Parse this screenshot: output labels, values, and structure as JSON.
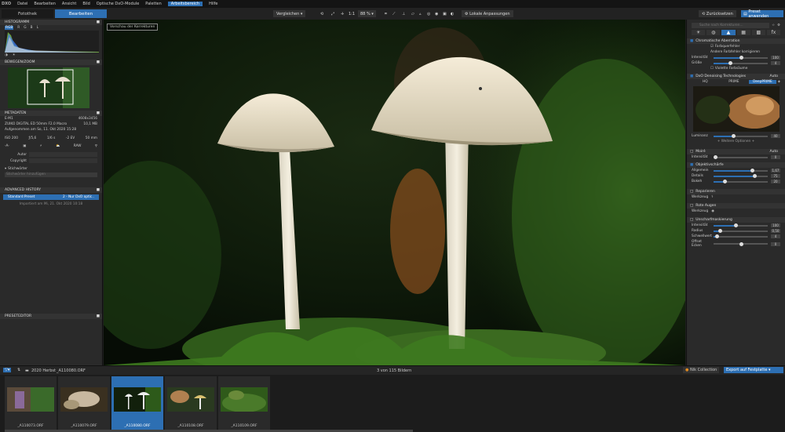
{
  "app": {
    "logo": "DXO"
  },
  "menu": [
    "Datei",
    "Bearbeiten",
    "Ansicht",
    "Bild",
    "Optische DxO-Module",
    "Paletten",
    "Arbeitsbereich",
    "Hilfe"
  ],
  "tabs": {
    "fototek": "Fotothek",
    "bearbeiten": "Bearbeiten"
  },
  "toolbar": {
    "compare": "Vergleichen",
    "zoom_fit": "1:1",
    "zoom": "88 %",
    "local": "Lokale Anpassungen",
    "reset": "Zurücksetzen",
    "preset": "Preset anwenden"
  },
  "left": {
    "histogram": "HISTOGRAMM",
    "hist_channels": [
      "RGB",
      "R",
      "G",
      "B",
      "L"
    ],
    "navigator": "BEWEGEN/ZOOM",
    "metadata": "METADATEN",
    "camera": "E-M1",
    "dims": "4608x3456",
    "lens": "ZUIKO DIGITAL ED 50mm F2.0 Macro",
    "size": "10,1 MB",
    "taken": "Aufgenommen am So, 11. Okt 2020 15:28",
    "exif": [
      "ISO 200",
      "ƒ/5,6",
      "1/6 s",
      "-2 EV",
      "50 mm"
    ],
    "author_label": "Autor",
    "copyright_label": "Copyright",
    "keywords": "Stichwörter",
    "keywords_ph": "Stichwörter hinzufügen",
    "history": "ADVANCED HISTORY",
    "hist_item1": "Standard Preset",
    "hist_item1b": "2 - Nur DxO optic..",
    "hist_note": "Importiert am Mi, 21. Okt 2020 10:18",
    "preset_editor": "PRESETEDITOR"
  },
  "viewer": {
    "label": "Vorschau der Korrekturen"
  },
  "right": {
    "search_ph": "Suche nach Korrekturen...",
    "ca": "Chromatische Aberration",
    "ca_opt1": "Farbquerfehler",
    "ca_opt2": "Andere Farbfehler korrigieren",
    "ca_int": "Intensität",
    "ca_int_v": "100",
    "ca_size": "Größe",
    "ca_size_v": "4",
    "ca_opt3": "Violette Farbsäume",
    "denoise": "DxO Denoising Technologies",
    "denoise_auto": "Auto",
    "dn_modes": [
      "HQ",
      "PRIME",
      "DeepPRIME"
    ],
    "luminance": "Luminanz",
    "lum_v": "40",
    "more": "+ Weitere Optionen +",
    "moire": "Moiré",
    "moire_auto": "Auto",
    "moire_int": "Intensität",
    "moire_v": "0",
    "sharp": "Objektivschärfe",
    "sharp_rows": [
      {
        "label": "Allgemein",
        "v": "1,67"
      },
      {
        "label": "Details",
        "v": "75"
      },
      {
        "label": "Bokeh",
        "v": "20"
      }
    ],
    "repair": "Reparieren",
    "tool": "Werkzeug",
    "redeye": "Rote Augen",
    "tool2": "Werkzeug",
    "usm": "Unscharfmaskierung",
    "usm_rows": [
      {
        "label": "Intensität",
        "v": "100"
      },
      {
        "label": "Radius",
        "v": "0,50"
      },
      {
        "label": "Schwellwert",
        "v": "4"
      },
      {
        "label": "Offset Ecken",
        "v": "0"
      }
    ]
  },
  "filmbar": {
    "folder": "2020 Herbst",
    "file": "_A110080.ORF",
    "count": "3 von 115 Bildern",
    "nik": "Nik Collection",
    "export": "Export auf Festplatte"
  },
  "thumbs": [
    "_A110073.ORF",
    "_A110079.ORF",
    "_A110080.ORF",
    "_A110108.ORF",
    "_A110109.ORF"
  ],
  "colors": {
    "accent": "#2d6fb3",
    "bg": "#1e1e1e",
    "panel": "#2a2a2a"
  }
}
